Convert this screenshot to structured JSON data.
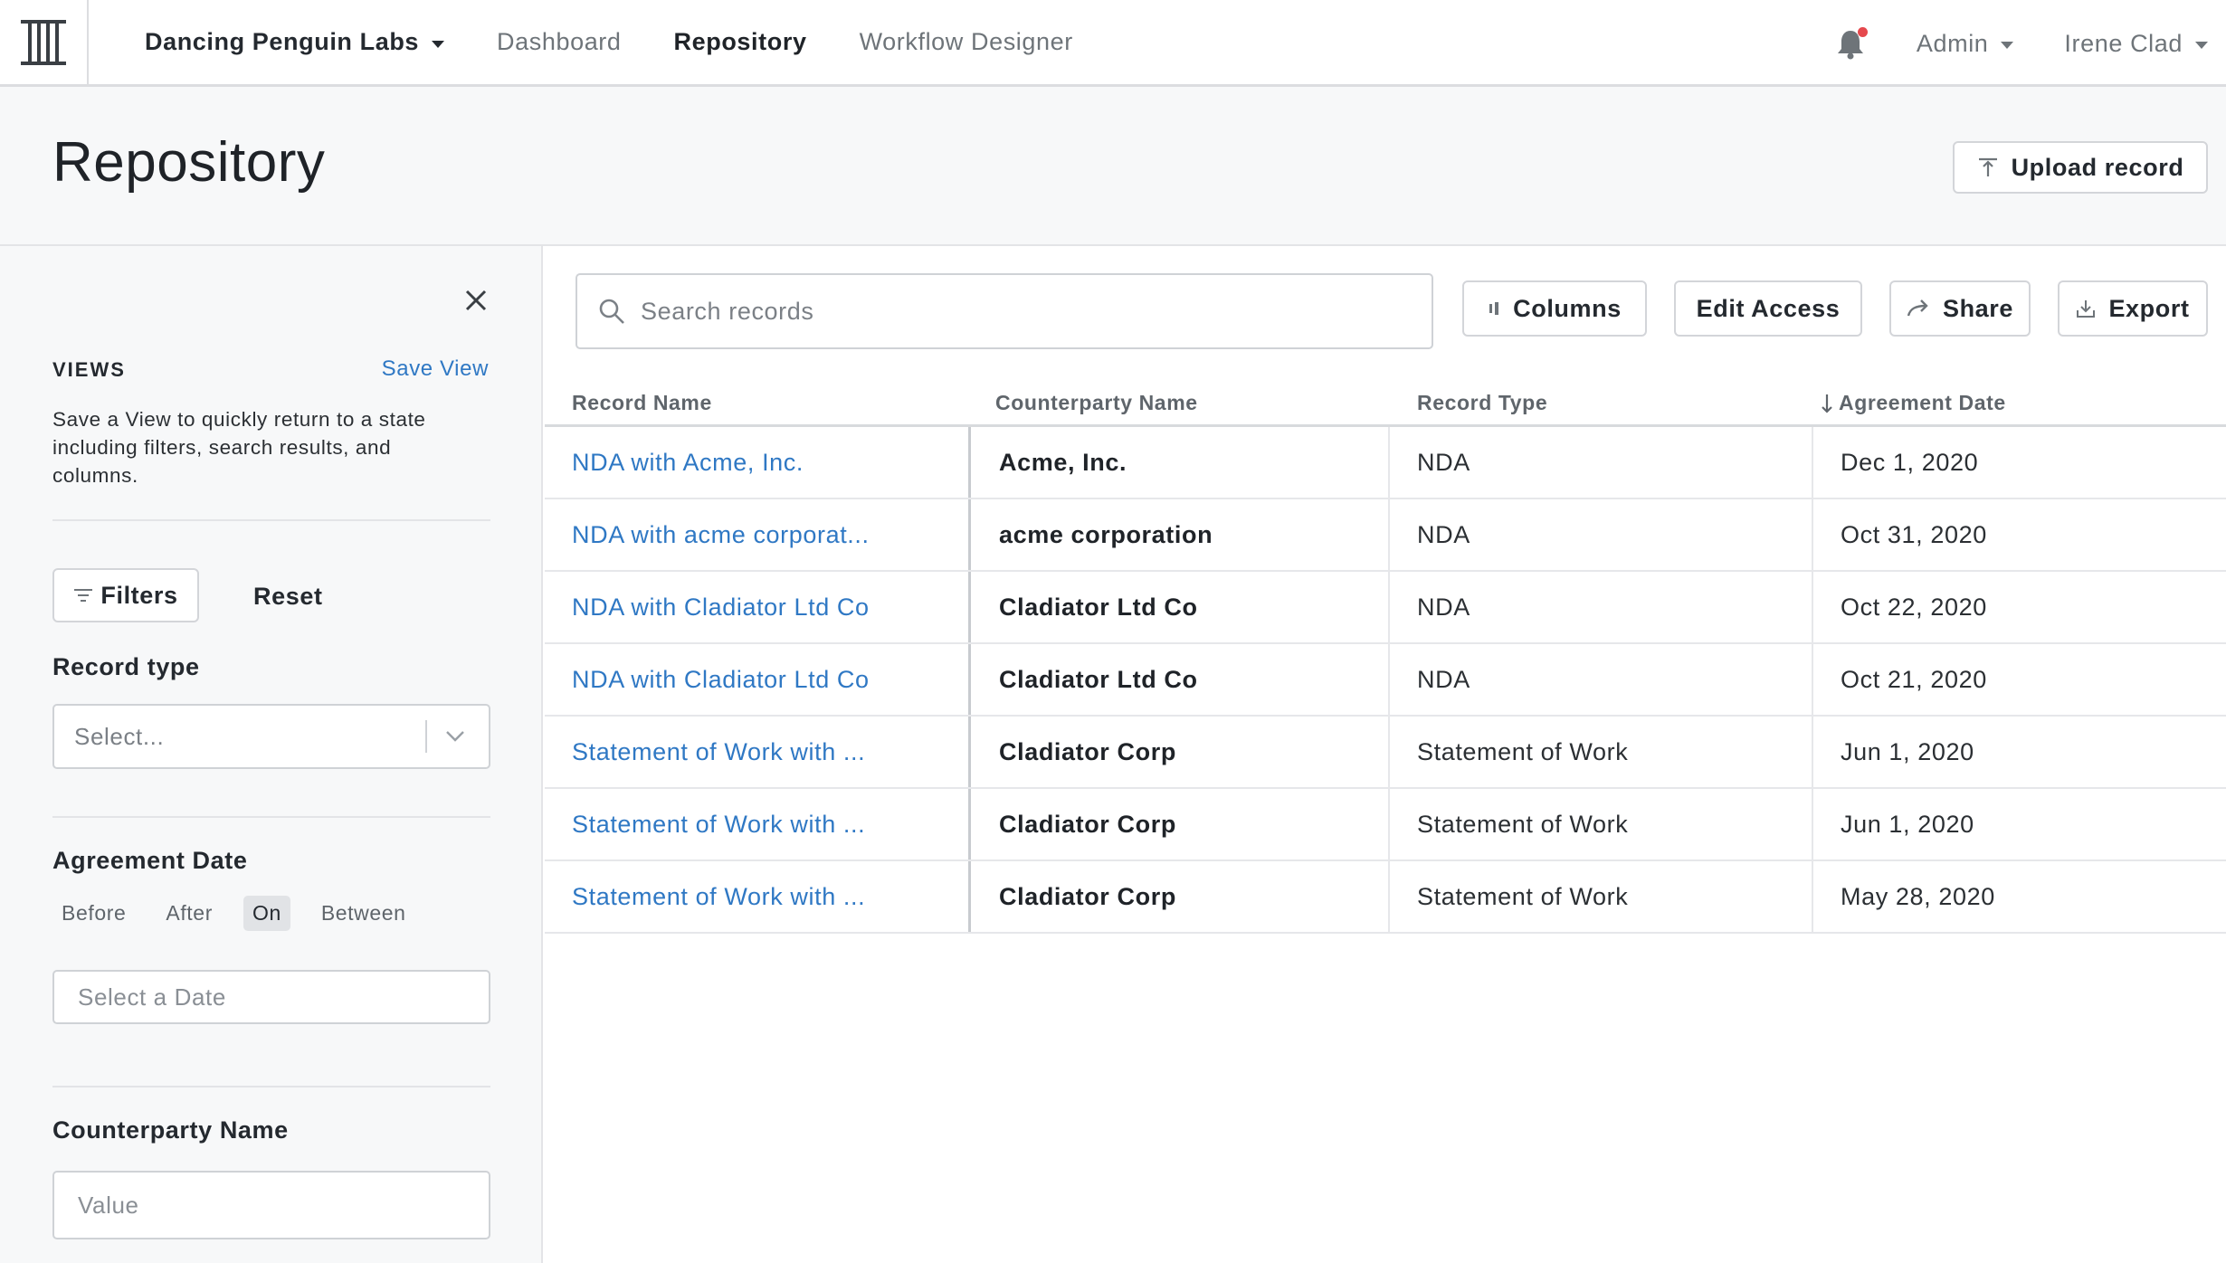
{
  "nav": {
    "org": "Dancing Penguin Labs",
    "links": [
      "Dashboard",
      "Repository",
      "Workflow Designer"
    ],
    "admin": "Admin",
    "user": "Irene Clad"
  },
  "header": {
    "title": "Repository",
    "upload_label": "Upload record"
  },
  "sidebar": {
    "views_label": "VIEWS",
    "save_view": "Save View",
    "views_description": "Save a View to quickly return to a state including filters, search results, and columns.",
    "filters_label": "Filters",
    "reset_label": "Reset",
    "record_type": {
      "label": "Record type",
      "placeholder": "Select..."
    },
    "agreement_date": {
      "label": "Agreement Date",
      "options": [
        "Before",
        "After",
        "On",
        "Between"
      ],
      "selected": "On",
      "placeholder": "Select a Date"
    },
    "counterparty": {
      "label": "Counterparty Name",
      "placeholder": "Value"
    }
  },
  "toolbar": {
    "search_placeholder": "Search records",
    "columns": "Columns",
    "edit_access": "Edit Access",
    "share": "Share",
    "export": "Export"
  },
  "table": {
    "columns": [
      "Record Name",
      "Counterparty Name",
      "Record Type",
      "Agreement Date"
    ],
    "sorted_column": "Agreement Date",
    "rows": [
      [
        "NDA with Acme, Inc.",
        "Acme, Inc.",
        "NDA",
        "Dec 1, 2020"
      ],
      [
        "NDA with acme corporat...",
        "acme corporation",
        "NDA",
        "Oct 31, 2020"
      ],
      [
        "NDA with Cladiator Ltd Co",
        "Cladiator Ltd Co",
        "NDA",
        "Oct 22, 2020"
      ],
      [
        "NDA with Cladiator Ltd Co",
        "Cladiator Ltd Co",
        "NDA",
        "Oct 21, 2020"
      ],
      [
        "Statement of Work with ...",
        "Cladiator Corp",
        "Statement of Work",
        "Jun 1, 2020"
      ],
      [
        "Statement of Work with ...",
        "Cladiator Corp",
        "Statement of Work",
        "Jun 1, 2020"
      ],
      [
        "Statement of Work with ...",
        "Cladiator Corp",
        "Statement of Work",
        "May 28, 2020"
      ]
    ]
  },
  "colors": {
    "link": "#2f78c4",
    "notification_dot": "#e5484d",
    "panel_background": "#f7f8f9"
  },
  "icons": {
    "logo": "brand-logo-icon",
    "notifications": "bell-icon",
    "upload": "upload-icon",
    "close": "close-icon",
    "filter": "filter-icon",
    "chevron": "chevron-down-icon",
    "search": "search-icon",
    "columns": "columns-icon",
    "share": "share-arrow-icon",
    "export": "download-icon",
    "sort": "arrow-down-icon"
  }
}
